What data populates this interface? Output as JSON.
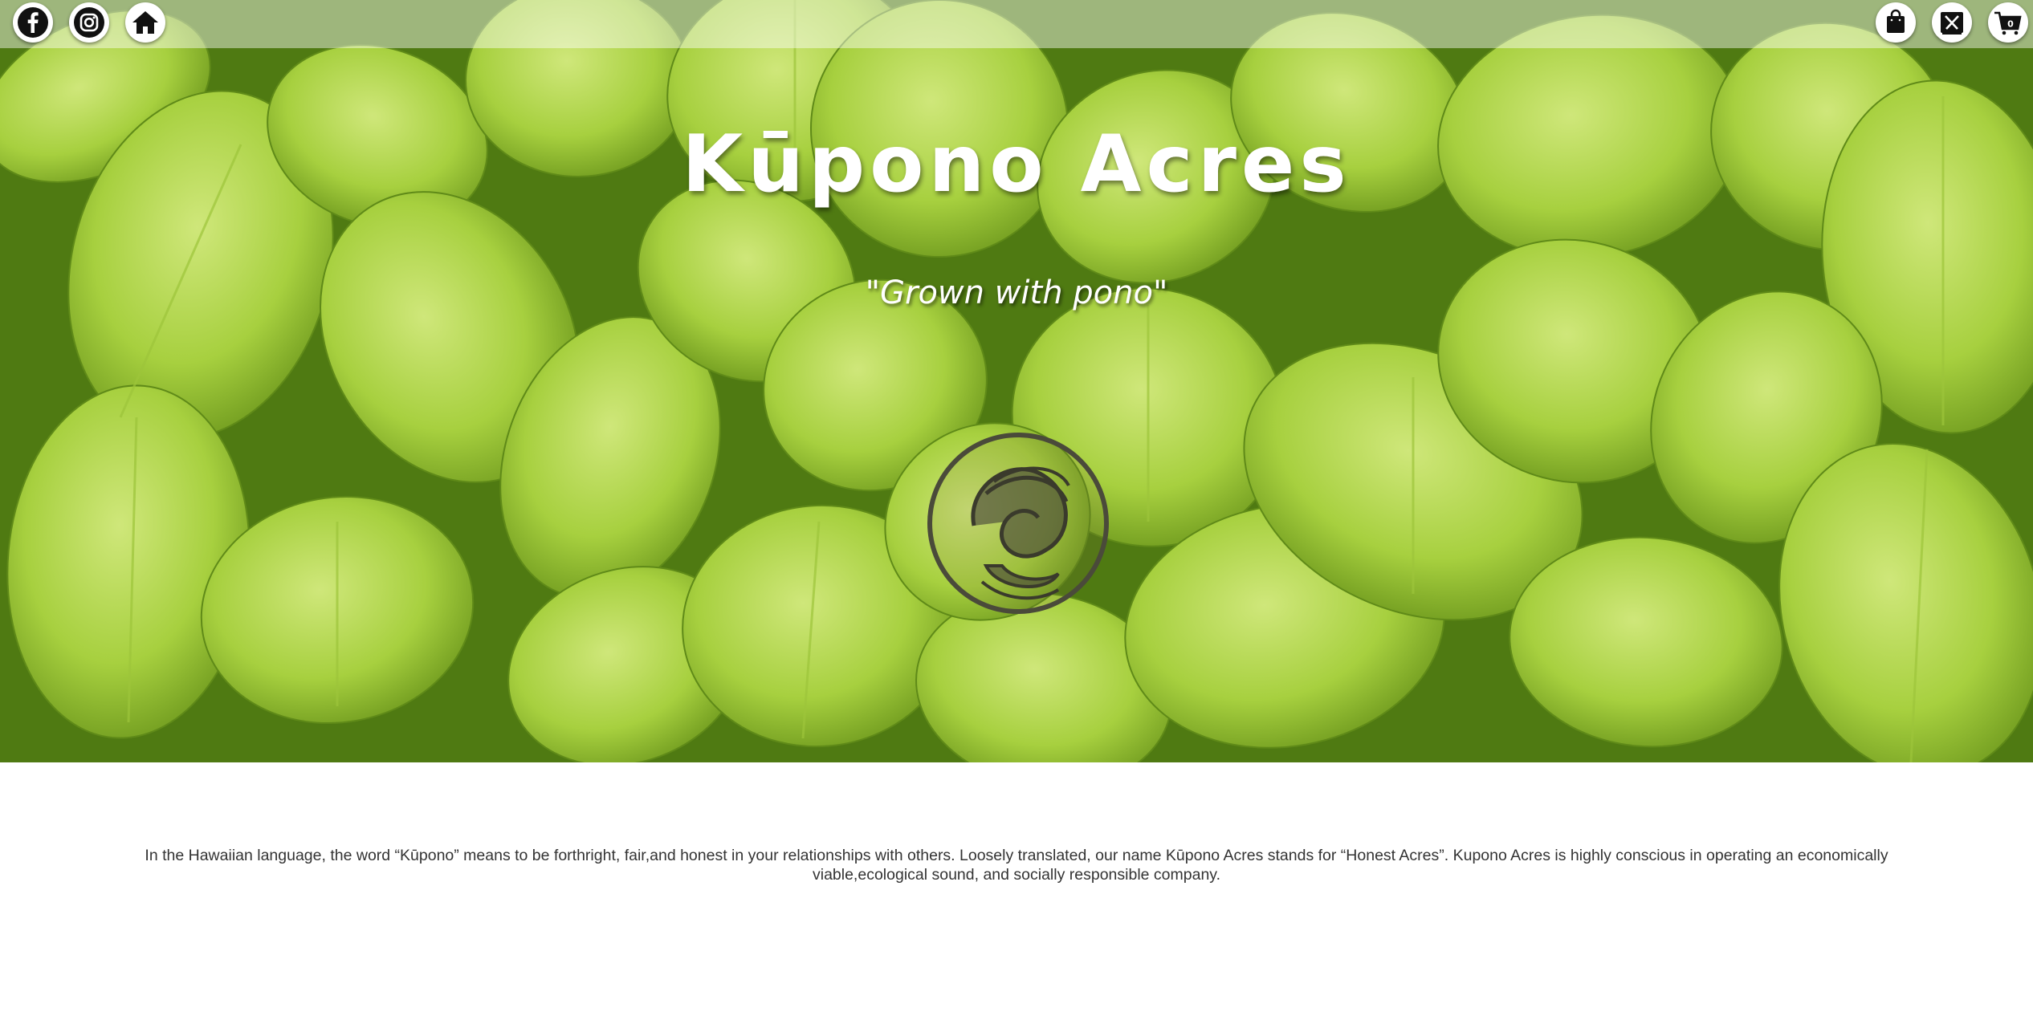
{
  "header": {
    "social": [
      {
        "name": "facebook-icon"
      },
      {
        "name": "instagram-icon"
      },
      {
        "name": "home-icon"
      }
    ],
    "actions": [
      {
        "name": "shopping-bag-icon"
      },
      {
        "name": "menu-utensils-icon"
      },
      {
        "name": "cart-icon",
        "count": "0"
      }
    ]
  },
  "hero": {
    "title": "Kūpono Acres",
    "tagline": "\"Grown with pono\"",
    "logo_icon": "kupono-acres-logo"
  },
  "about": {
    "text": "In the Hawaiian language, the word “Kūpono” means to be forthright, fair,and honest in your relationships with others. Loosely translated, our name Kūpono Acres stands for “Honest Acres”. Kupono Acres is highly conscious in operating an economically viable,ecological sound, and socially responsible company."
  },
  "colors": {
    "leaf_light": "#b8db57",
    "leaf_dark": "#6f9a1e",
    "logo": "#4a4a3a"
  }
}
